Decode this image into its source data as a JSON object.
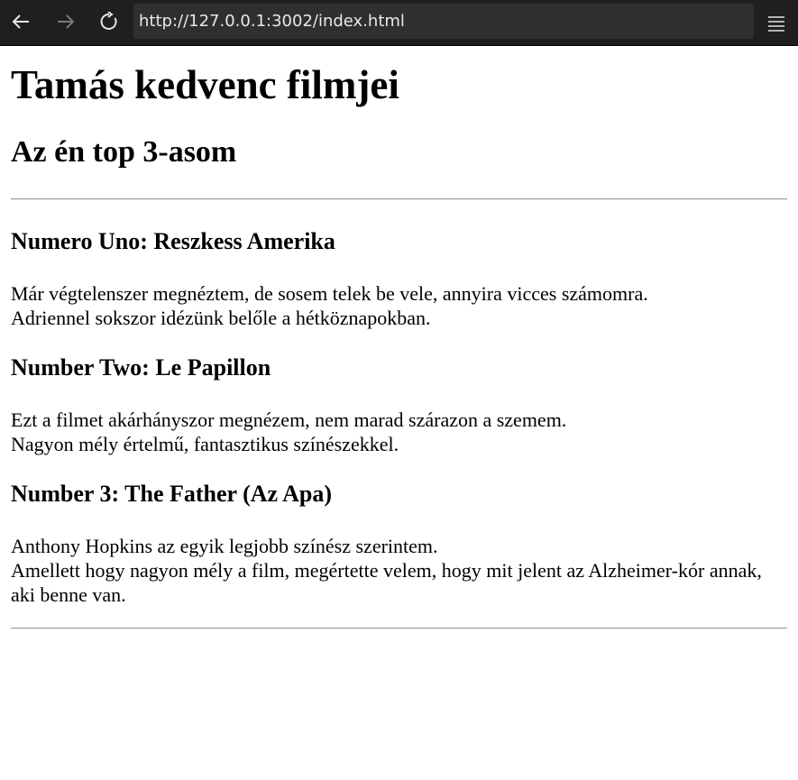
{
  "browser": {
    "back_icon": "arrow-left-icon",
    "forward_icon": "arrow-right-icon",
    "reload_icon": "reload-icon",
    "menu_icon": "hamburger-menu-icon",
    "url": "http://127.0.0.1:3002/index.html"
  },
  "page": {
    "title": "Tamás kedvenc filmjei",
    "subtitle": "Az én top 3-asom",
    "movies": [
      {
        "heading": "Numero Uno: Reszkess Amerika",
        "lines": [
          "Már végtelenszer megnéztem, de sosem telek be vele, annyira vicces számomra.",
          "Adriennel sokszor idézünk belőle a hétköznapokban."
        ]
      },
      {
        "heading": "Number Two: Le Papillon",
        "lines": [
          "Ezt a filmet akárhányszor megnézem, nem marad szárazon a szemem.",
          "Nagyon mély értelmű, fantasztikus színészekkel."
        ]
      },
      {
        "heading": "Number 3: The Father (Az Apa)",
        "lines": [
          "Anthony Hopkins az egyik legjobb színész szerintem.",
          "Amellett hogy nagyon mély a film, megértette velem, hogy mit jelent az Alzheimer-kór annak, aki benne van."
        ]
      }
    ]
  }
}
